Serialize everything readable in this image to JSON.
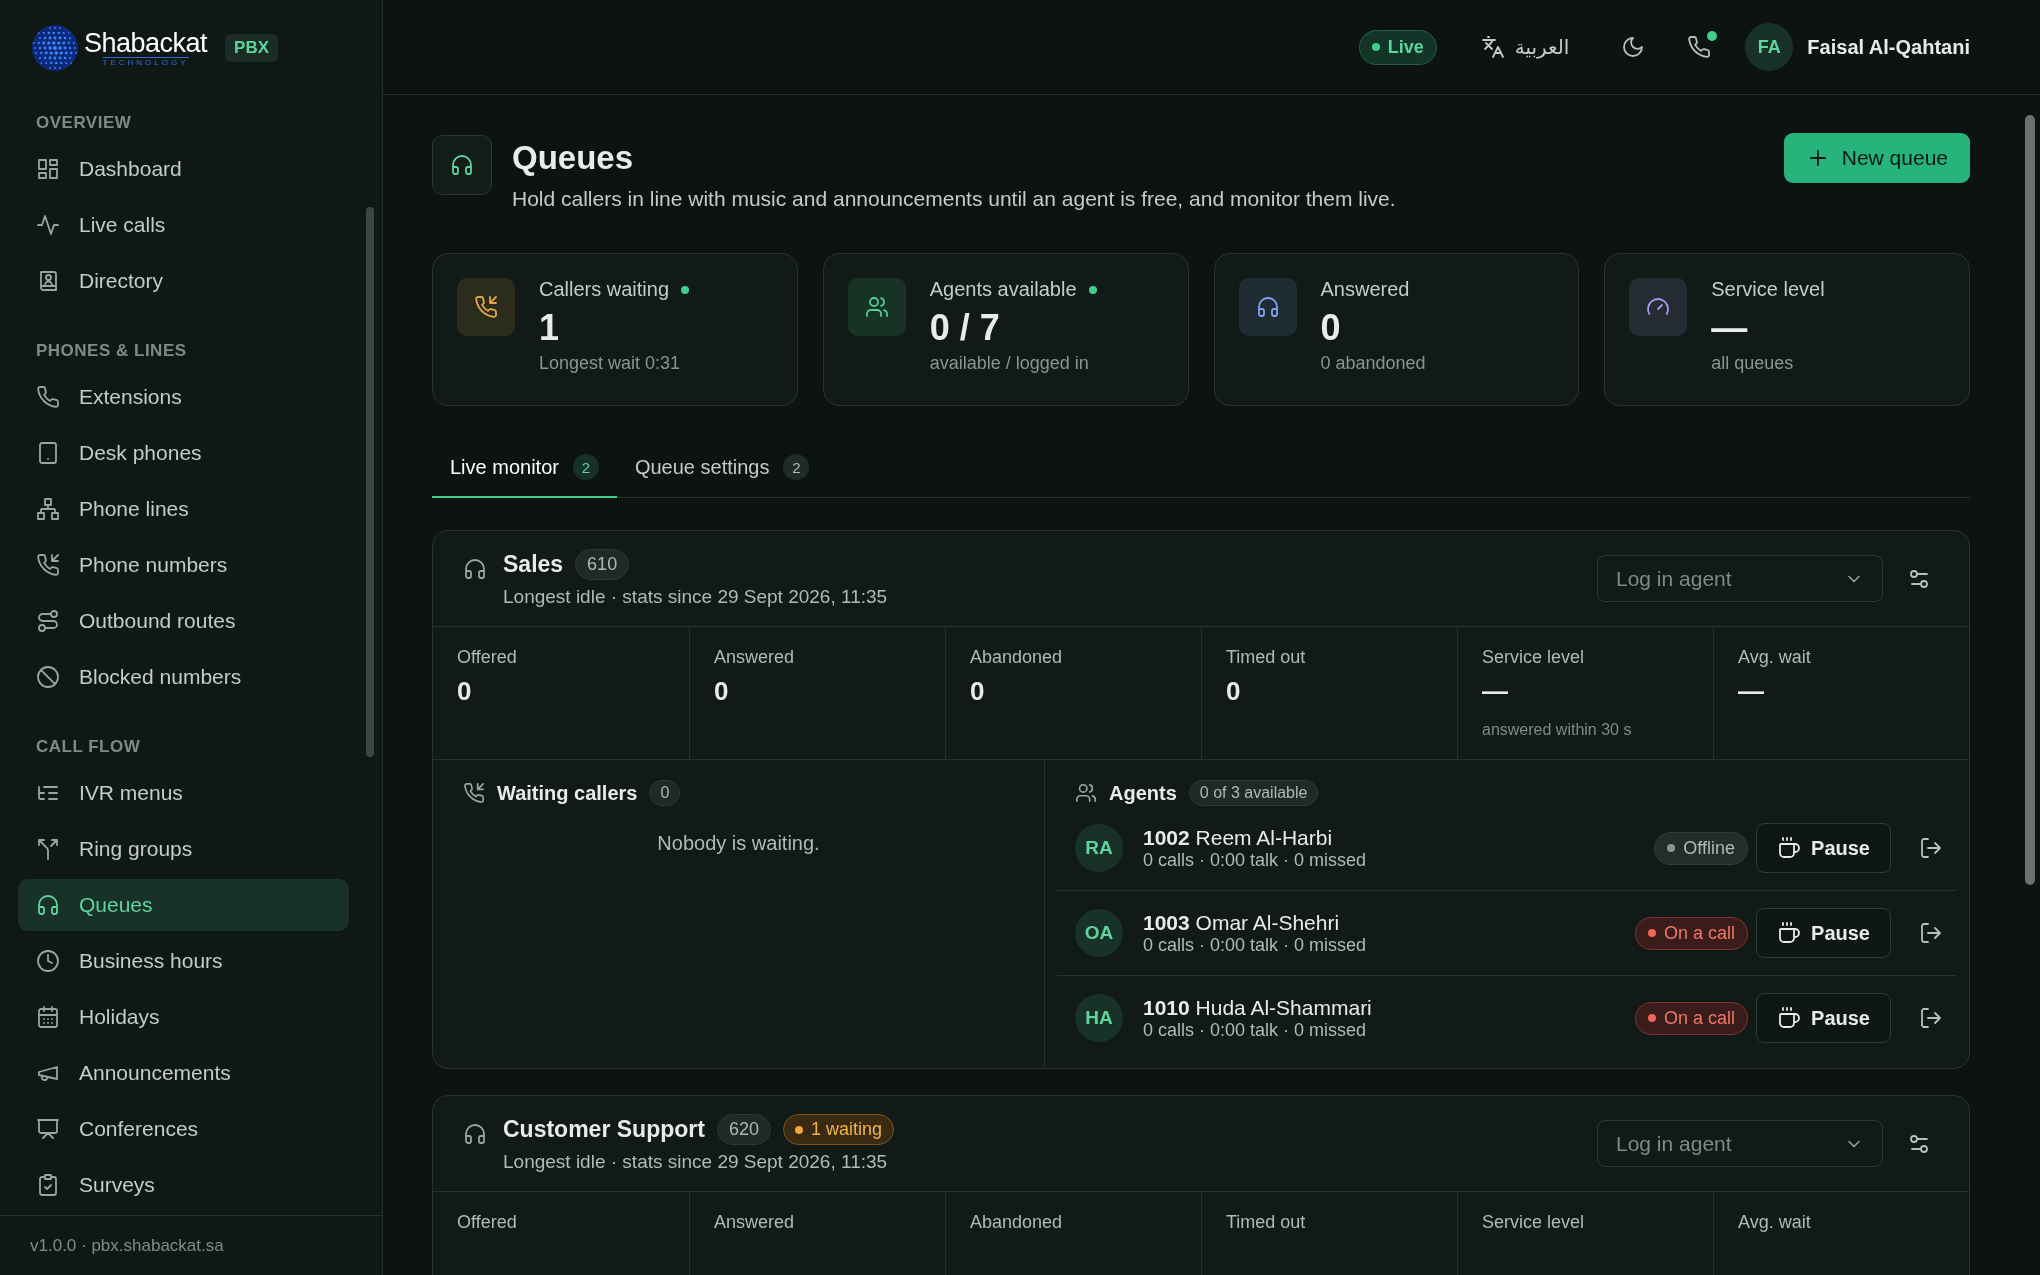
{
  "brand": {
    "name": "Shabackat",
    "tagline": "TECHNOLOGY",
    "badge": "PBX"
  },
  "sidebar": {
    "sections": [
      {
        "title": "OVERVIEW",
        "items": [
          {
            "label": "Dashboard",
            "selected": false
          },
          {
            "label": "Live calls",
            "selected": false
          },
          {
            "label": "Directory",
            "selected": false
          }
        ]
      },
      {
        "title": "PHONES & LINES",
        "items": [
          {
            "label": "Extensions",
            "selected": false
          },
          {
            "label": "Desk phones",
            "selected": false
          },
          {
            "label": "Phone lines",
            "selected": false
          },
          {
            "label": "Phone numbers",
            "selected": false
          },
          {
            "label": "Outbound routes",
            "selected": false
          },
          {
            "label": "Blocked numbers",
            "selected": false
          }
        ]
      },
      {
        "title": "CALL FLOW",
        "items": [
          {
            "label": "IVR menus",
            "selected": false
          },
          {
            "label": "Ring groups",
            "selected": false
          },
          {
            "label": "Queues",
            "selected": true
          },
          {
            "label": "Business hours",
            "selected": false
          },
          {
            "label": "Holidays",
            "selected": false
          },
          {
            "label": "Announcements",
            "selected": false
          },
          {
            "label": "Conferences",
            "selected": false
          },
          {
            "label": "Surveys",
            "selected": false
          }
        ]
      }
    ],
    "footer": "v1.0.0 · pbx.shabackat.sa"
  },
  "header": {
    "live": "Live",
    "language": "العربية",
    "user": {
      "initials": "FA",
      "name": "Faisal Al-Qahtani"
    }
  },
  "page": {
    "title": "Queues",
    "subtitle": "Hold callers in line with music and announcements until an agent is free, and monitor them live.",
    "new_button": "New queue"
  },
  "stats": [
    {
      "label": "Callers waiting",
      "live": true,
      "value": "1",
      "sub": "Longest wait 0:31",
      "color": "#e3a548"
    },
    {
      "label": "Agents available",
      "live": true,
      "value": "0 / 7",
      "sub": "available / logged in",
      "color": "#4fcf92"
    },
    {
      "label": "Answered",
      "live": false,
      "value": "0",
      "sub": "0 abandoned",
      "color": "#7ea6f0"
    },
    {
      "label": "Service level",
      "live": false,
      "value": "—",
      "sub": "all queues",
      "color": "#a99af0"
    }
  ],
  "tabs": [
    {
      "label": "Live monitor",
      "count": "2",
      "selected": true
    },
    {
      "label": "Queue settings",
      "count": "2",
      "selected": false
    }
  ],
  "queues": [
    {
      "name": "Sales",
      "number": "610",
      "subtitle": "Longest idle · stats since 29 Sept 2026, 11:35",
      "select": "Log in agent",
      "metrics": [
        {
          "label": "Offered",
          "value": "0"
        },
        {
          "label": "Answered",
          "value": "0"
        },
        {
          "label": "Abandoned",
          "value": "0"
        },
        {
          "label": "Timed out",
          "value": "0"
        },
        {
          "label": "Service level",
          "value": "—",
          "note": "answered within 30 s"
        },
        {
          "label": "Avg. wait",
          "value": "—"
        }
      ],
      "waiting": {
        "title": "Waiting callers",
        "count": "0",
        "empty": "Nobody is waiting."
      },
      "agents": {
        "title": "Agents",
        "summary": "0 of 3 available",
        "rows": [
          {
            "initials": "RA",
            "ext": "1002",
            "name": "Reem Al-Harbi",
            "stats": "0 calls · 0:00 talk · 0 missed",
            "status": {
              "kind": "offline",
              "label": "Offline"
            },
            "pause": "Pause"
          },
          {
            "initials": "OA",
            "ext": "1003",
            "name": "Omar Al-Shehri",
            "stats": "0 calls · 0:00 talk · 0 missed",
            "status": {
              "kind": "on_call",
              "label": "On a call"
            },
            "pause": "Pause"
          },
          {
            "initials": "HA",
            "ext": "1010",
            "name": "Huda Al-Shammari",
            "stats": "0 calls · 0:00 talk · 0 missed",
            "status": {
              "kind": "on_call",
              "label": "On a call"
            },
            "pause": "Pause"
          }
        ]
      }
    },
    {
      "name": "Customer Support",
      "number": "620",
      "waiting_badge": "1 waiting",
      "subtitle": "Longest idle · stats since 29 Sept 2026, 11:35",
      "select": "Log in agent",
      "metrics": [
        {
          "label": "Offered"
        },
        {
          "label": "Answered"
        },
        {
          "label": "Abandoned"
        },
        {
          "label": "Timed out"
        },
        {
          "label": "Service level"
        },
        {
          "label": "Avg. wait"
        }
      ]
    }
  ]
}
